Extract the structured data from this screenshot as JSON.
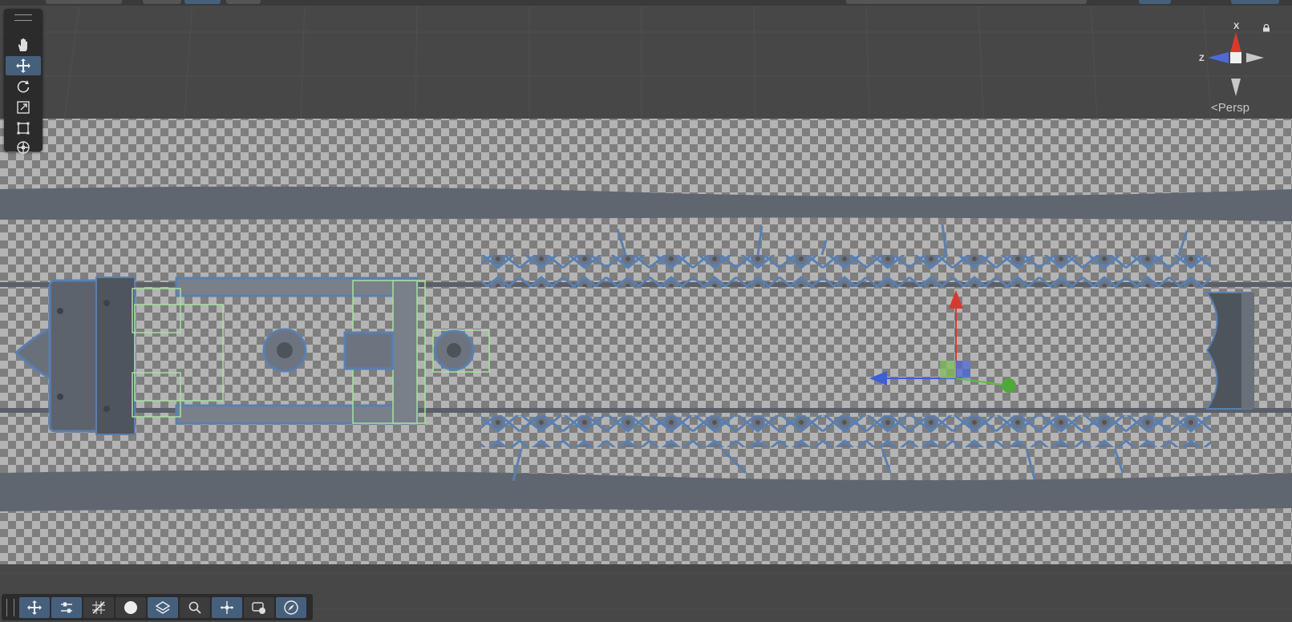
{
  "view": {
    "projection_label": "Persp",
    "axis_labels": {
      "x": "X",
      "z": "Z"
    }
  },
  "toolbox": {
    "tools": [
      {
        "name": "view-tool",
        "icon": "hand-icon",
        "active": false
      },
      {
        "name": "move-tool",
        "icon": "move-arrows-icon",
        "active": true
      },
      {
        "name": "rotate-tool",
        "icon": "rotate-icon",
        "active": false
      },
      {
        "name": "scale-tool",
        "icon": "scale-icon",
        "active": false
      },
      {
        "name": "rect-tool",
        "icon": "rect-transform-icon",
        "active": false
      },
      {
        "name": "transform-tool",
        "icon": "transform-icon",
        "active": false
      }
    ]
  },
  "overlay_toolbar": {
    "buttons": [
      {
        "name": "move-snap",
        "icon": "move-snap-icon",
        "active": true
      },
      {
        "name": "tool-settings",
        "icon": "sliders-icon",
        "active": true
      },
      {
        "name": "grid-snapping",
        "icon": "grid-snap-icon",
        "active": false
      },
      {
        "name": "shading-mode",
        "icon": "sphere-icon",
        "active": false
      },
      {
        "name": "layers",
        "icon": "layers-icon",
        "active": true
      },
      {
        "name": "search",
        "icon": "search-icon",
        "active": false
      },
      {
        "name": "pivot-center",
        "icon": "pivot-icon",
        "active": true
      },
      {
        "name": "camera-view",
        "icon": "camera-icon",
        "active": false
      },
      {
        "name": "orientation",
        "icon": "compass-icon",
        "active": true
      }
    ]
  },
  "colors": {
    "background": "#474747",
    "checker_light": "#b4b4b4",
    "checker_dark": "#7e7e7e",
    "selection_outline": "#5a7fb0",
    "wireframe_green": "#a8e0a0",
    "axis_x": "#d63a2f",
    "axis_y": "#5cc13c",
    "axis_z": "#3a5fd6",
    "active_button": "#46607c"
  }
}
